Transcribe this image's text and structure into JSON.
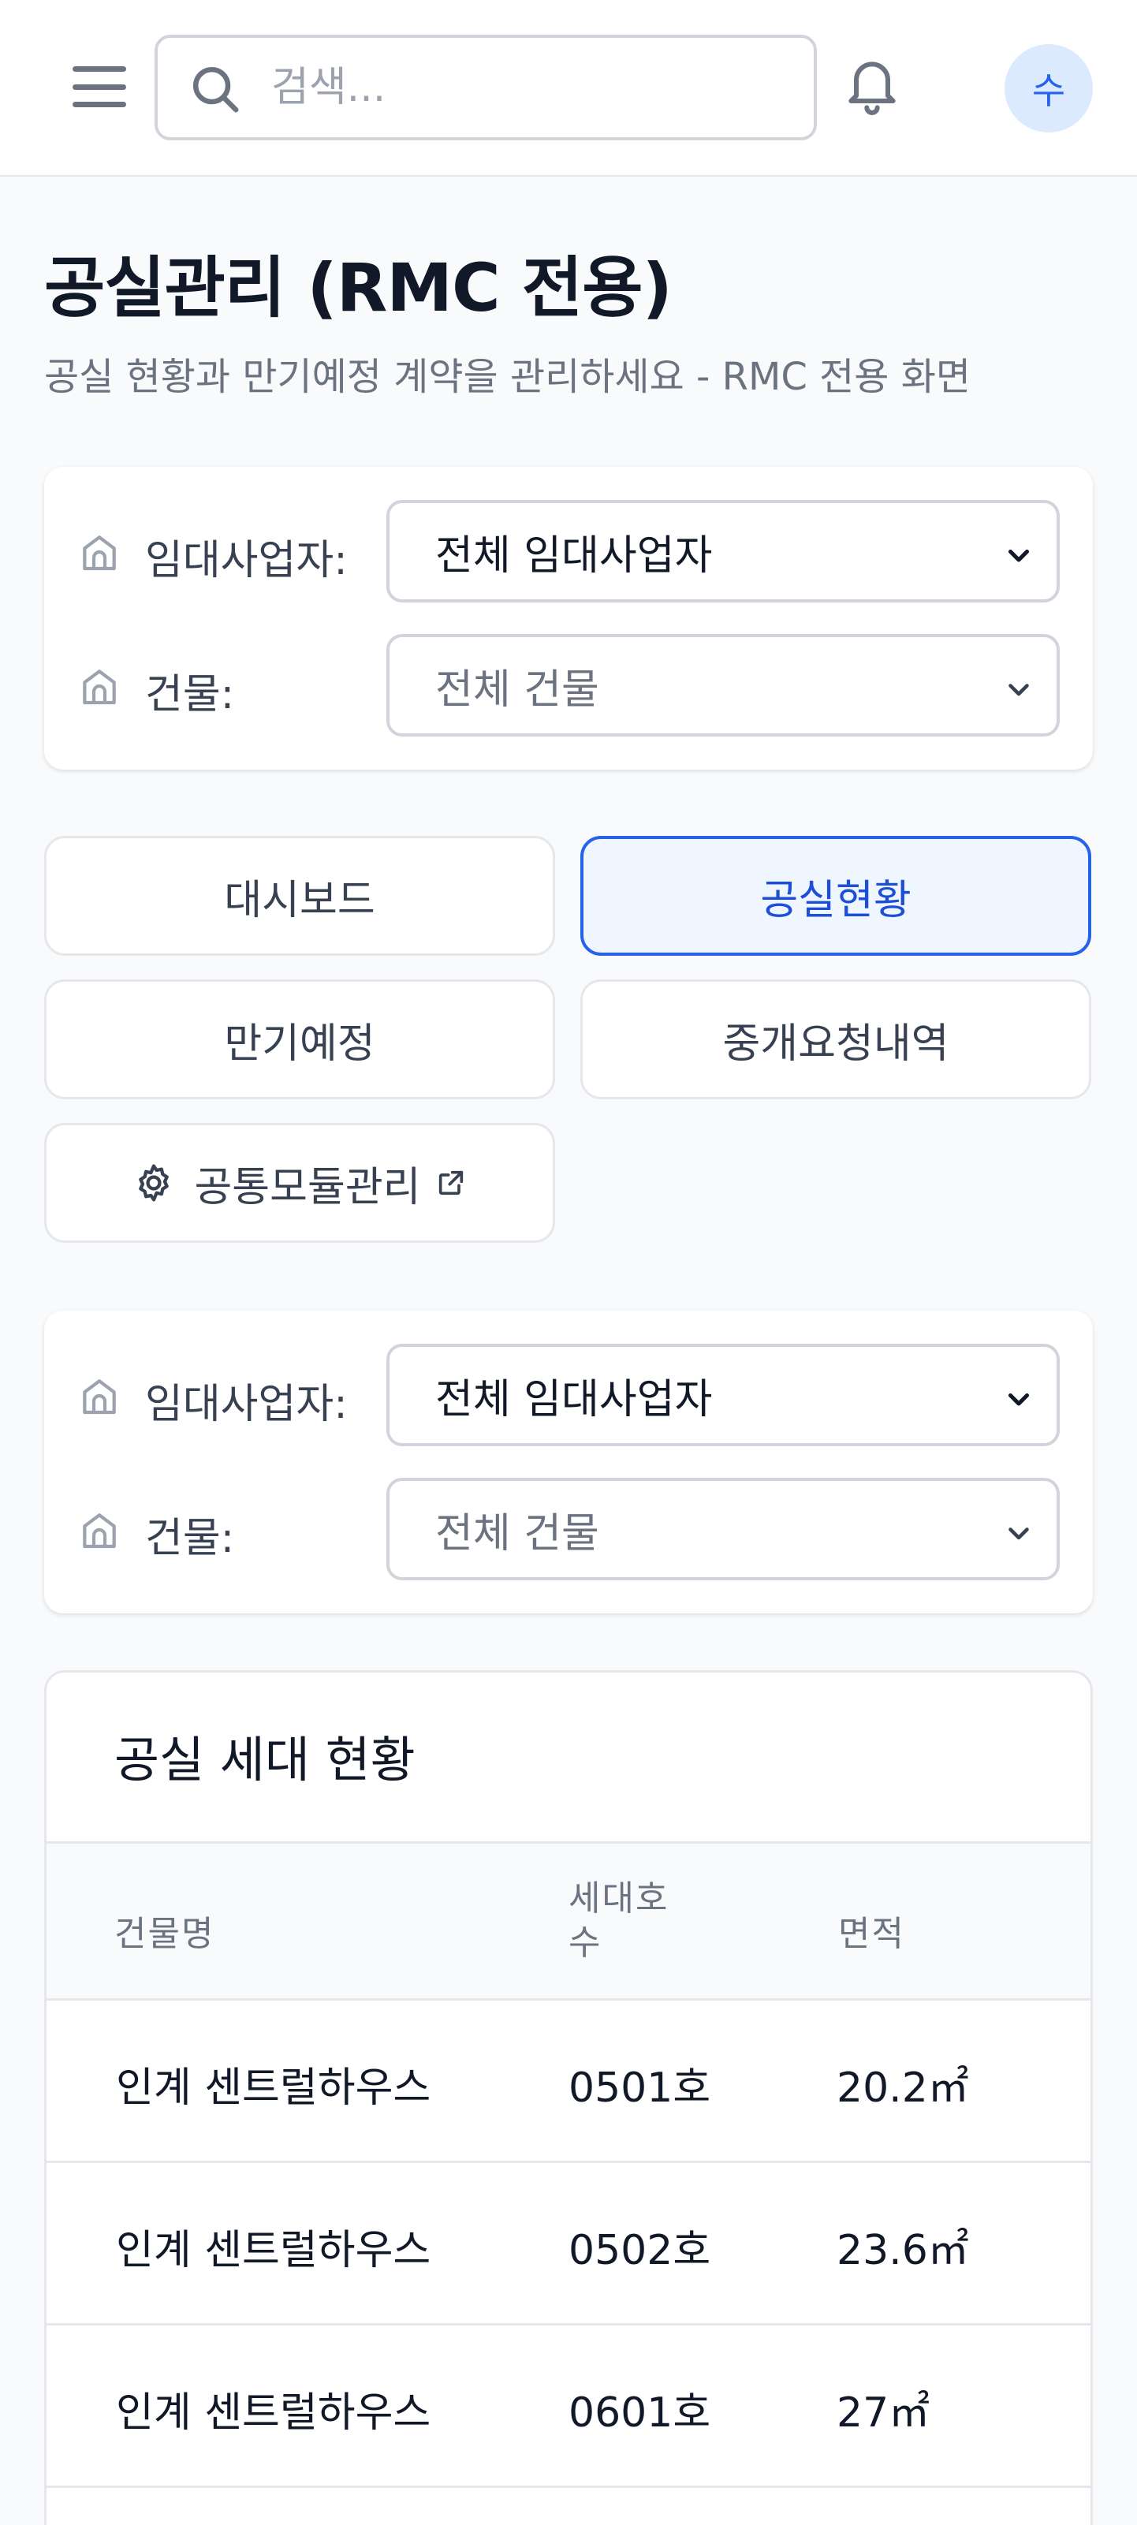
{
  "header": {
    "search_placeholder": "검색...",
    "avatar_initial": "수"
  },
  "page": {
    "title": "공실관리 (RMC 전용)",
    "subtitle": "공실 현황과 만기예정 계약을 관리하세요 - RMC 전용 화면"
  },
  "filters": {
    "lessor_label": "임대사업자:",
    "lessor_value": "전체 임대사업자",
    "building_label": "건물:",
    "building_value": "전체 건물"
  },
  "nav": {
    "dashboard": "대시보드",
    "vacancy_status": "공실현황",
    "expiring": "만기예정",
    "brokerage_requests": "중개요청내역",
    "common_module": "공통모듈관리",
    "active": "공실현황"
  },
  "table": {
    "title": "공실 세대 현황",
    "headers": [
      "건물명",
      "세대호수",
      "면적"
    ],
    "header_unit_line1": "세대호",
    "header_unit_line2": "수",
    "rows": [
      {
        "building": "인계 센트럴하우스",
        "unit": "0501호",
        "area": "20.2㎡"
      },
      {
        "building": "인계 센트럴하우스",
        "unit": "0502호",
        "area": "23.6㎡"
      },
      {
        "building": "인계 센트럴하우스",
        "unit": "0601호",
        "area": "27㎡"
      }
    ]
  },
  "colors": {
    "accent": "#2563eb",
    "active_bg": "#eff6ff",
    "avatar_bg": "#dbeafe"
  }
}
